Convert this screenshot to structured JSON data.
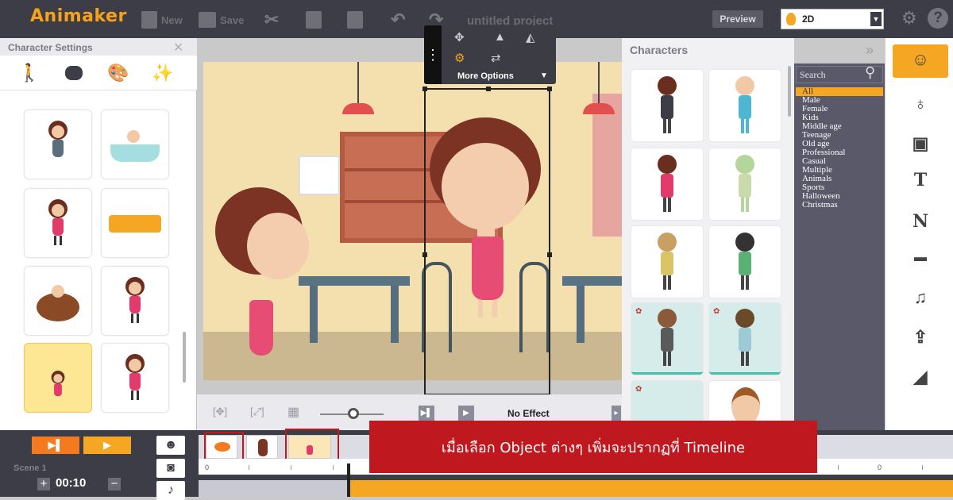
{
  "app": {
    "logo": "Animaker",
    "project_title": "untitled project"
  },
  "toolbar": {
    "new_label": "New",
    "save_label": "Save",
    "preview_label": "Preview",
    "mode_value": "2D"
  },
  "left_panel": {
    "title": "Character Settings"
  },
  "more_options": {
    "label": "More Options"
  },
  "canvas_toolbar": {
    "effect_label": "No Effect"
  },
  "characters_panel": {
    "title": "Characters",
    "search_placeholder": "Search",
    "filters": [
      "All",
      "Male",
      "Female",
      "Kids",
      "Middle age",
      "Teenage",
      "Old age",
      "Professional",
      "Casual",
      "Multiple",
      "Animals",
      "Sports",
      "Halloween",
      "Christmas"
    ]
  },
  "timeline": {
    "scene_label": "Scene 1",
    "duration": "00:10",
    "ruler_start": "0",
    "ruler_mid": "0"
  },
  "annotation": {
    "text": "เมื่อเลือก Object ต่างๆ เพิ่มจะปรากฏที่ Timeline"
  },
  "colors": {
    "accent": "#f5a623",
    "topbar": "#3d3d47",
    "annotation": "#c0181f"
  }
}
